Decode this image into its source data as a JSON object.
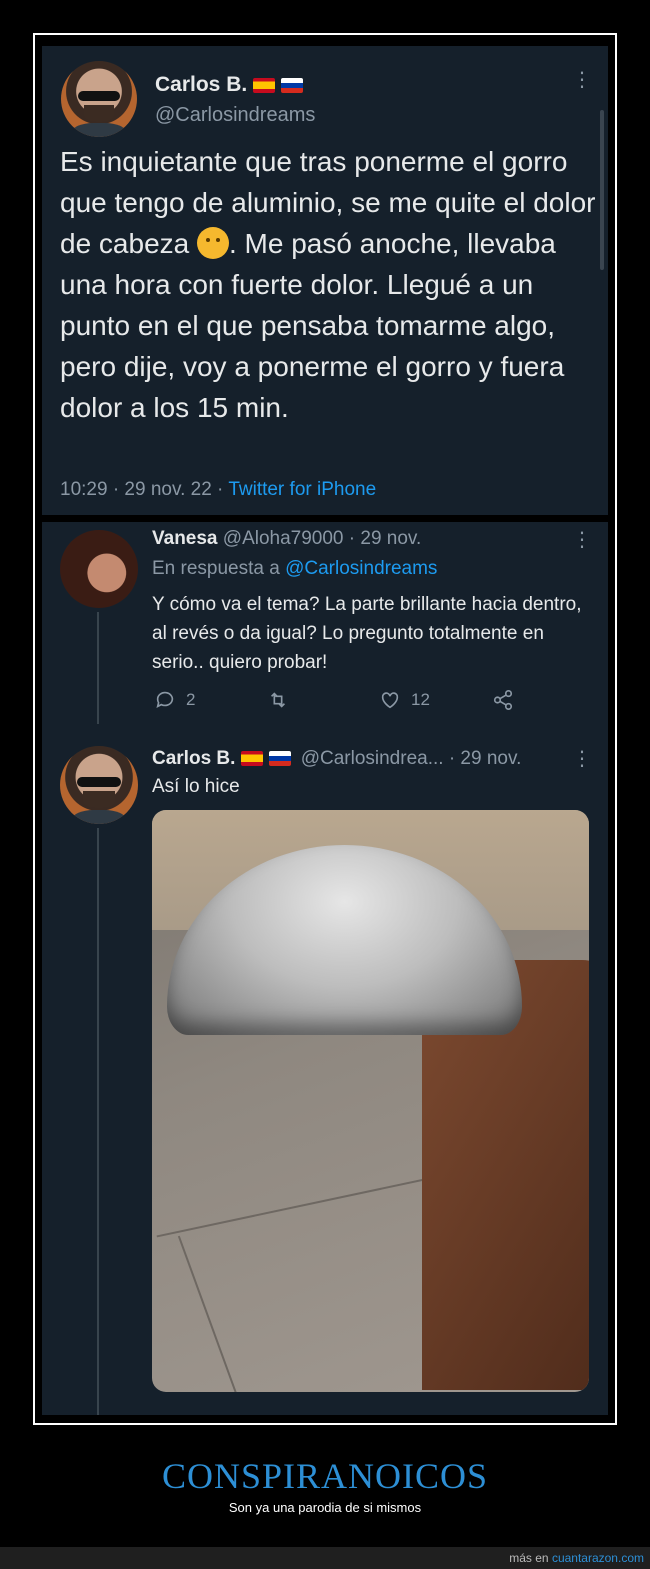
{
  "tweet": {
    "author_name": "Carlos B.",
    "author_handle": "@Carlosindreams",
    "text_part1": "Es inquietante que tras ponerme el gorro que tengo de aluminio, se me quite el dolor de cabeza ",
    "text_part2": ". Me pasó anoche, llevaba una hora con fuerte dolor. Llegué a un punto en el que pensaba tomarme algo, pero dije, voy a ponerme el gorro y fuera dolor a los 15 min.",
    "time": "10:29 · 29 nov. 22 · ",
    "source": "Twitter for iPhone",
    "emoji": "thinking-face"
  },
  "reply1": {
    "author_name": "Vanesa",
    "author_handle_date": "@Aloha79000 · 29 nov.",
    "in_reply_to_prefix": "En respuesta a ",
    "in_reply_to_handle": "@Carlosindreams",
    "text": "Y cómo va el tema? La parte brillante hacia dentro, al revés o da igual? Lo pregunto totalmente en serio.. quiero probar!",
    "replies": "2",
    "retweets": "",
    "likes": "12"
  },
  "reply2": {
    "author_name": "Carlos B.",
    "author_handle_date": "@Carlosindrea... · 29 nov.",
    "text": "Así lo hice"
  },
  "footer": {
    "title": "CONSPIRANOICOS",
    "subtitle": "Son ya una parodia de si mismos",
    "credit_prefix": "más en ",
    "credit_link": "cuantarazon.com"
  },
  "colors": {
    "card_bg": "#15202b",
    "link": "#1d9bf0",
    "muted": "#8b98a5",
    "footer_title": "#2d8fd5"
  }
}
